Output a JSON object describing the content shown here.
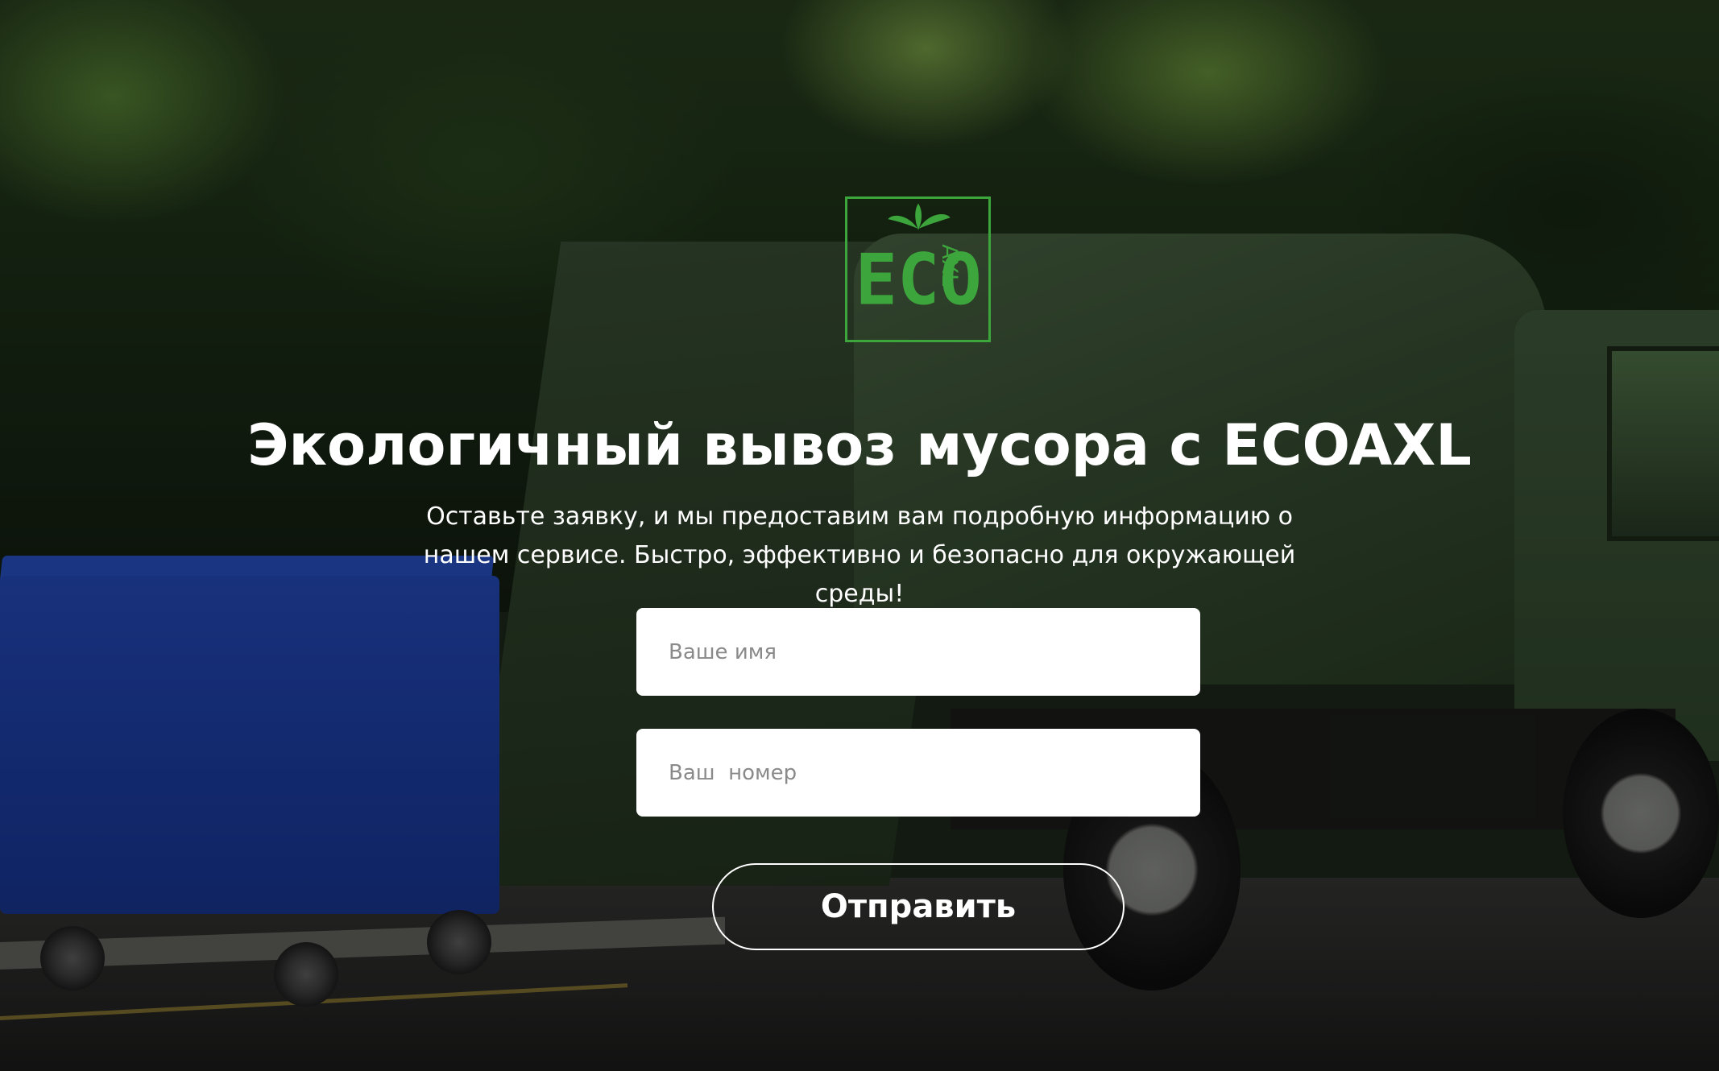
{
  "brand": {
    "logo_text_main": "ECO",
    "logo_text_side": "AXL",
    "logo_color": "#3ca63c",
    "logo_icon": "leaf-icon"
  },
  "hero": {
    "headline": "Экологичный вывоз мусора с ECOAXL",
    "subtitle": "Оставьте заявку, и мы предоставим вам подробную информацию о нашем сервисе. Быстро, эффективно и безопасно для окружающей среды!"
  },
  "form": {
    "name_placeholder": "Ваше имя",
    "phone_placeholder": "Ваш  номер",
    "submit_label": "Отправить"
  },
  "colors": {
    "text": "#ffffff",
    "field_background": "#ffffff",
    "placeholder": "#8a8a8a"
  }
}
